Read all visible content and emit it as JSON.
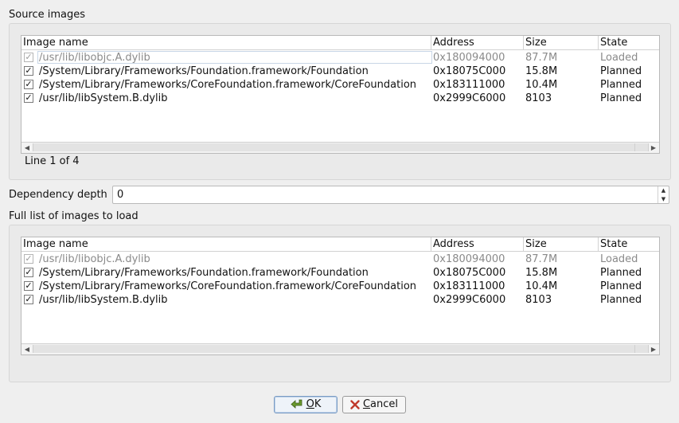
{
  "source": {
    "title": "Source images",
    "columns": [
      "Image name",
      "Address",
      "Size",
      "State"
    ],
    "rows": [
      {
        "checked": true,
        "name": "/usr/lib/libobjc.A.dylib",
        "address": "0x180094000",
        "size": "87.7M",
        "state": "Loaded",
        "dim": true
      },
      {
        "checked": true,
        "name": "/System/Library/Frameworks/Foundation.framework/Foundation",
        "address": "0x18075C000",
        "size": "15.8M",
        "state": "Planned",
        "dim": false
      },
      {
        "checked": true,
        "name": "/System/Library/Frameworks/CoreFoundation.framework/CoreFoundation",
        "address": "0x183111000",
        "size": "10.4M",
        "state": "Planned",
        "dim": false
      },
      {
        "checked": true,
        "name": "/usr/lib/libSystem.B.dylib",
        "address": "0x2999C6000",
        "size": "8103",
        "state": "Planned",
        "dim": false
      }
    ],
    "status": "Line 1 of 4"
  },
  "depth": {
    "label": "Dependency depth",
    "value": "0"
  },
  "full": {
    "title": "Full list of images to load",
    "columns": [
      "Image name",
      "Address",
      "Size",
      "State"
    ],
    "rows": [
      {
        "checked": true,
        "name": "/usr/lib/libobjc.A.dylib",
        "address": "0x180094000",
        "size": "87.7M",
        "state": "Loaded",
        "dim": true
      },
      {
        "checked": true,
        "name": "/System/Library/Frameworks/Foundation.framework/Foundation",
        "address": "0x18075C000",
        "size": "15.8M",
        "state": "Planned",
        "dim": false
      },
      {
        "checked": true,
        "name": "/System/Library/Frameworks/CoreFoundation.framework/CoreFoundation",
        "address": "0x183111000",
        "size": "10.4M",
        "state": "Planned",
        "dim": false
      },
      {
        "checked": true,
        "name": "/usr/lib/libSystem.B.dylib",
        "address": "0x2999C6000",
        "size": "8103",
        "state": "Planned",
        "dim": false
      }
    ]
  },
  "buttons": {
    "ok_prefix": "",
    "ok_mnemonic": "O",
    "ok_rest": "K",
    "cancel_mnemonic": "C",
    "cancel_rest": "ancel"
  },
  "icons": {
    "checkmark": "✓",
    "ok": "ok-arrow-icon",
    "cancel": "cancel-x-icon"
  },
  "colors": {
    "ok_icon": "#5a8a2a",
    "cancel_icon": "#c0392b",
    "focus_border": "#7a9cc4"
  }
}
